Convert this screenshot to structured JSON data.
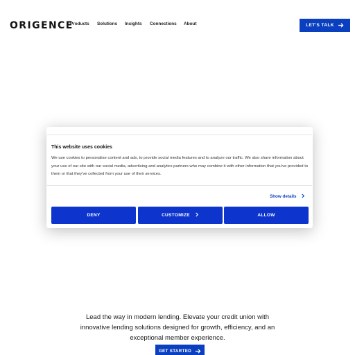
{
  "header": {
    "logo": "ORIGENCE",
    "nav": [
      "Products",
      "Solutions",
      "Insights",
      "Connections",
      "About"
    ],
    "cta_label": "LET'S TALK"
  },
  "cookie_dialog": {
    "title": "This website uses cookies",
    "body": "We use cookies to personalise content and ads, to provide social media features and to analyze our traffic. We also share information about your use of our site with our social media, advertising and analytics partners who may combine it with other information that you've provided to them or that they've collected from your use of their services.",
    "show_details": "Show details",
    "deny": "DENY",
    "customize": "CUSTOMIZE",
    "allow": "ALLOW"
  },
  "hero": {
    "text": "Lead the way in modern lending. Elevate your credit union with innovative lending solutions designed for growth, efficiency, and an exceptional member experience.",
    "cta_label": "GET STARTED"
  },
  "colors": {
    "brand_blue": "#0a3fbf",
    "cookie_button_blue": "#0d34cc"
  }
}
